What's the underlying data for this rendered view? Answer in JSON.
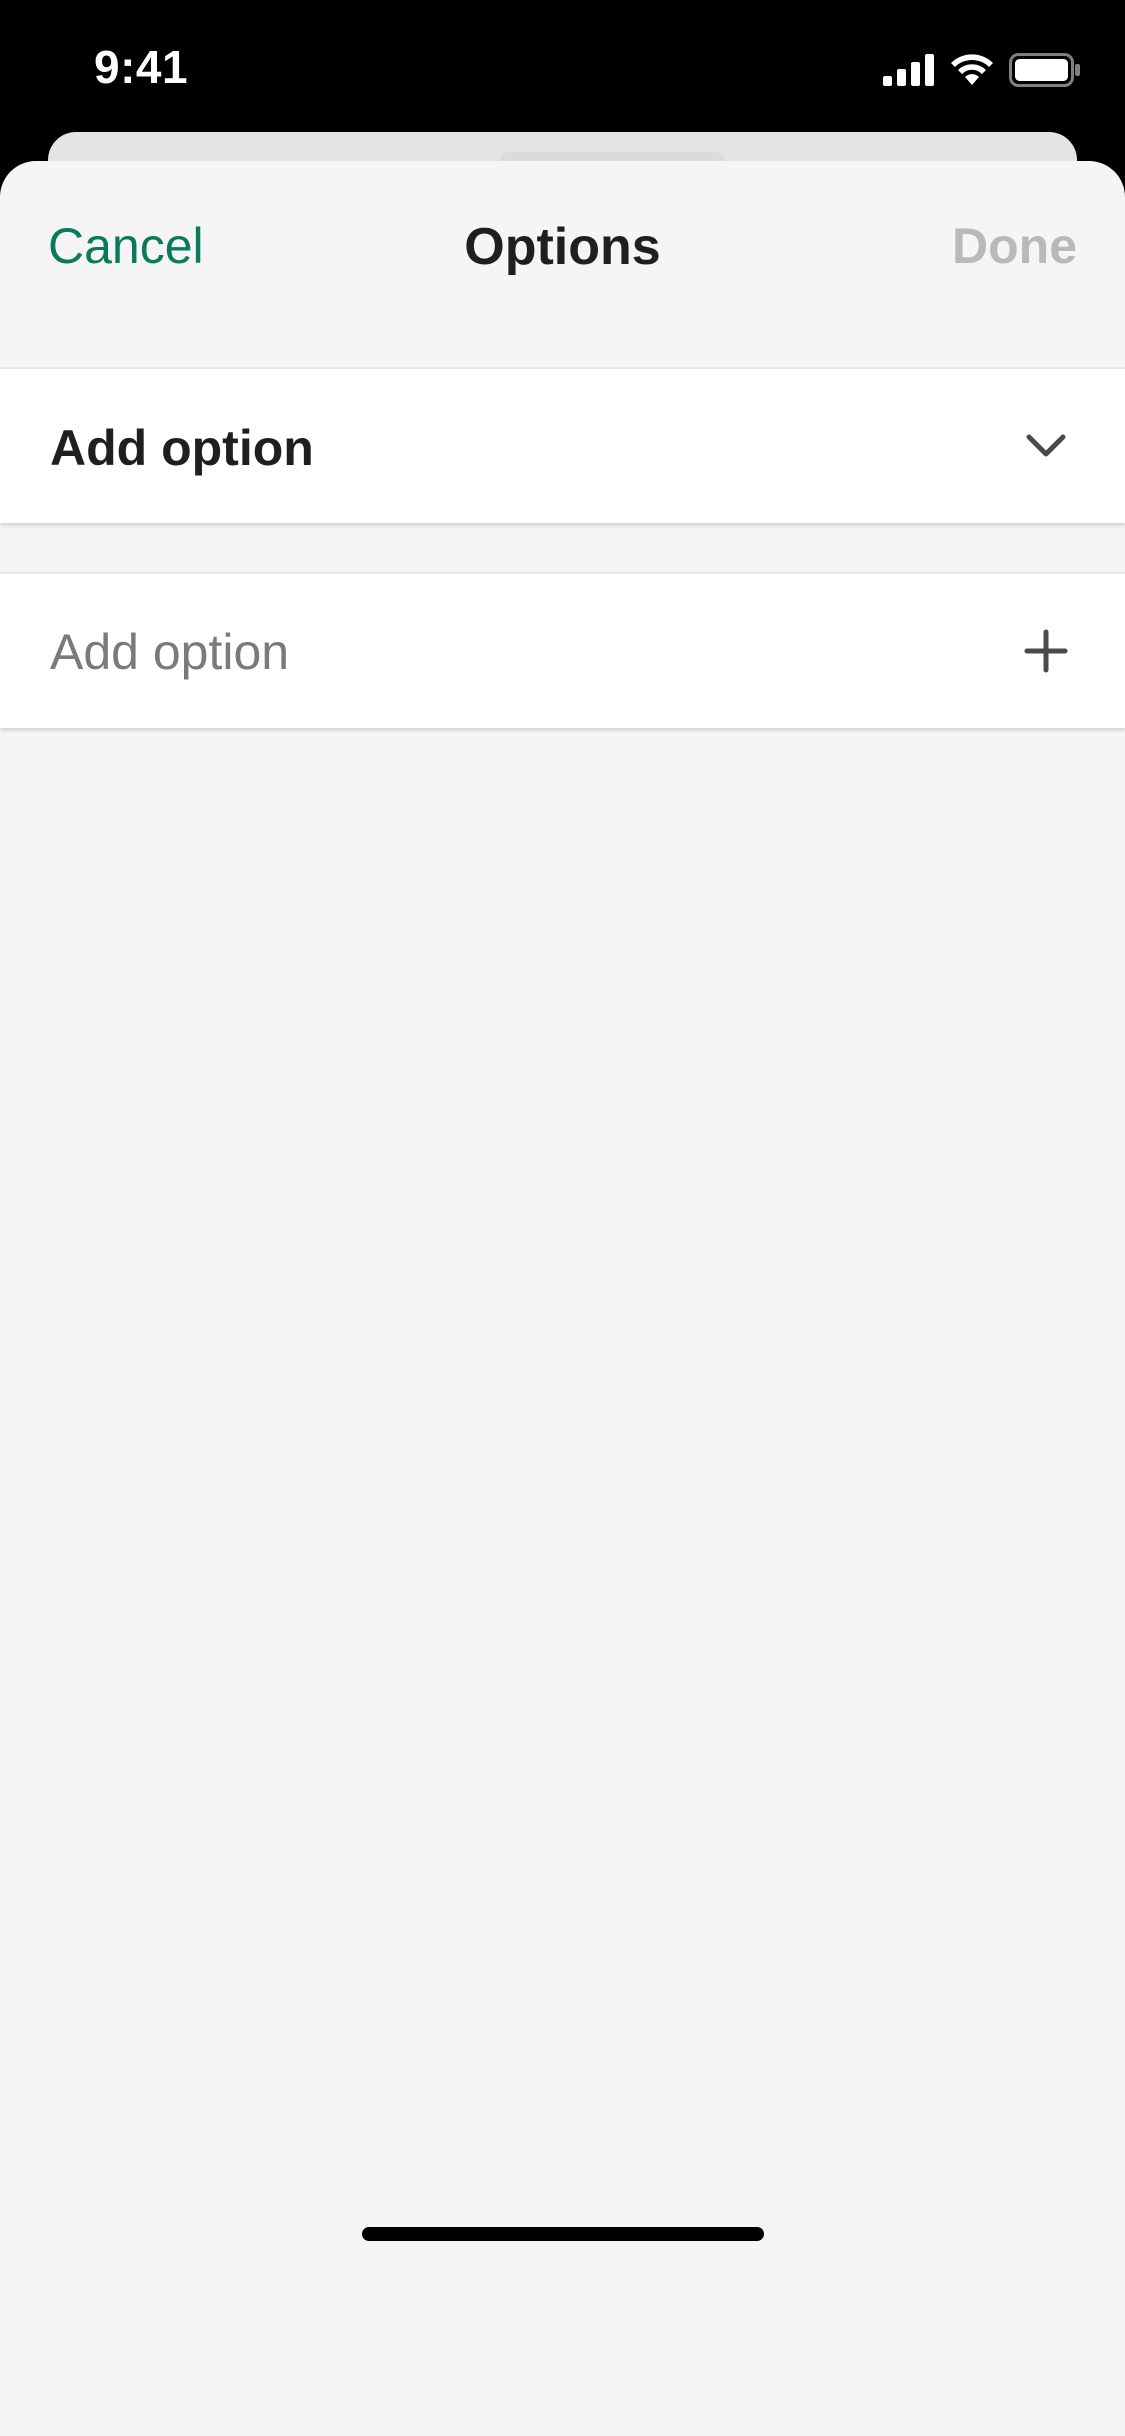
{
  "status_bar": {
    "time": "9:41",
    "icons": [
      "signal-icon",
      "wifi-icon",
      "battery-icon"
    ]
  },
  "nav": {
    "cancel_label": "Cancel",
    "title": "Options",
    "done_label": "Done"
  },
  "option_select": {
    "label": "Add option",
    "icon": "chevron-down-icon"
  },
  "option_input": {
    "placeholder": "Add option",
    "value": "",
    "icon": "plus-icon"
  },
  "colors": {
    "accent": "#0a7a5c",
    "disabled": "#b9b9b9",
    "background": "#f5f5f5",
    "text": "#1f1f1f",
    "placeholder": "#7a7a7a"
  }
}
